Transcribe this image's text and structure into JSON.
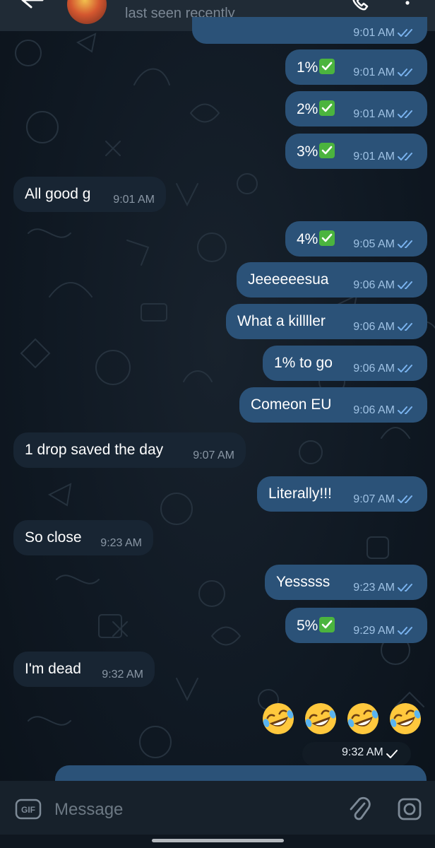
{
  "header": {
    "status": "last seen recently"
  },
  "messages": [
    {
      "text": "1%",
      "check_emoji": true,
      "time": "9:01 AM",
      "outgoing": true
    },
    {
      "text": "2%",
      "check_emoji": true,
      "time": "9:01 AM",
      "outgoing": true
    },
    {
      "text": "3%",
      "check_emoji": true,
      "time": "9:01 AM",
      "outgoing": true
    },
    {
      "text": "All good g",
      "time": "9:01 AM",
      "outgoing": false
    },
    {
      "text": "4%",
      "check_emoji": true,
      "time": "9:05 AM",
      "outgoing": true
    },
    {
      "text": "Jeeeeeesua",
      "time": "9:06 AM",
      "outgoing": true
    },
    {
      "text": "What a killller",
      "time": "9:06 AM",
      "outgoing": true
    },
    {
      "text": "1% to go",
      "time": "9:06 AM",
      "outgoing": true
    },
    {
      "text": "Comeon EU",
      "time": "9:06 AM",
      "outgoing": true
    },
    {
      "text": "1 drop saved the day",
      "time": "9:07 AM",
      "outgoing": false
    },
    {
      "text": "Literally!!!",
      "time": "9:07 AM",
      "outgoing": true
    },
    {
      "text": "So close",
      "time": "9:23 AM",
      "outgoing": false
    },
    {
      "text": "Yesssss",
      "time": "9:23 AM",
      "outgoing": true
    },
    {
      "text": "5%",
      "check_emoji": true,
      "time": "9:29 AM",
      "outgoing": true
    },
    {
      "text": "I'm dead",
      "time": "9:32 AM",
      "outgoing": false
    }
  ],
  "top_partial_time": "9:01 AM",
  "emoji_message": {
    "emojis": [
      "rofl-emoji",
      "rofl-emoji",
      "rofl-emoji",
      "rofl-emoji"
    ],
    "time": "9:32 AM"
  },
  "input": {
    "placeholder": "Message",
    "value": "",
    "gif_label": "GIF"
  },
  "colors": {
    "background": "#0e1621",
    "outgoing_bubble": "#2b5278",
    "incoming_bubble": "#182533",
    "read_check": "#7ab3ef"
  }
}
